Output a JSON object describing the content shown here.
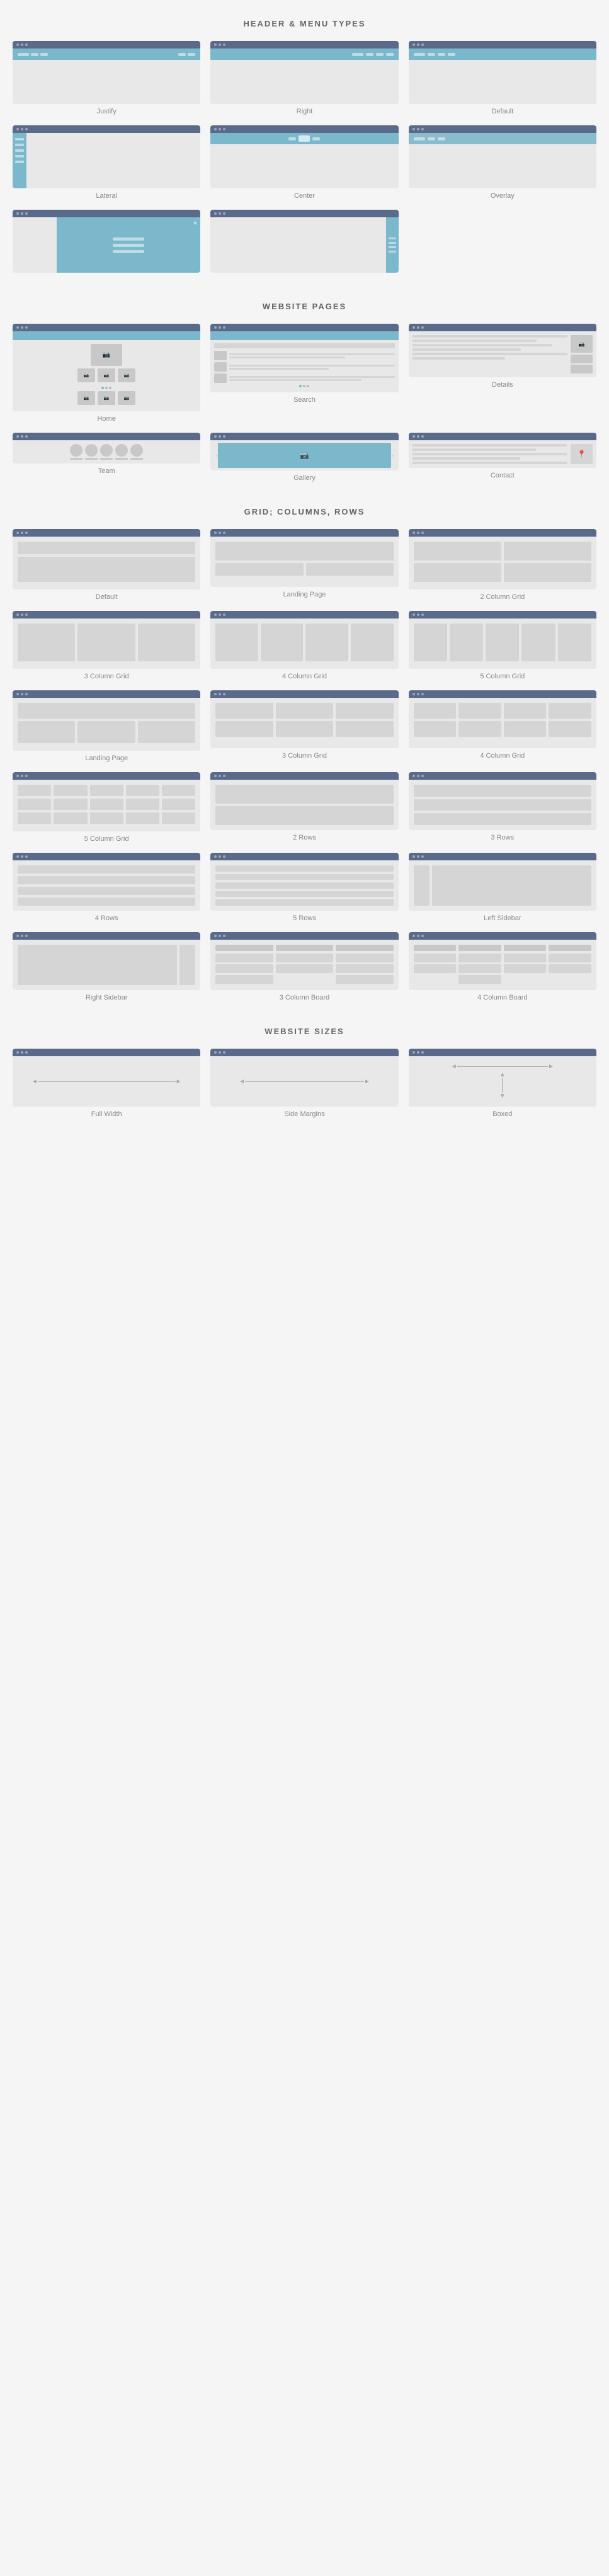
{
  "sections": {
    "header_menu": {
      "title": "HEADER & MENU TYPES",
      "items": [
        {
          "label": "Justify"
        },
        {
          "label": "Right"
        },
        {
          "label": "Default"
        },
        {
          "label": "Lateral"
        },
        {
          "label": "Center"
        },
        {
          "label": "Overlay"
        },
        {
          "label": ""
        },
        {
          "label": ""
        },
        {
          "label": ""
        }
      ]
    },
    "website_pages": {
      "title": "WEBSITE PAGES",
      "items": [
        {
          "label": "Home"
        },
        {
          "label": "Search"
        },
        {
          "label": "Details"
        },
        {
          "label": "Team"
        },
        {
          "label": "Gallery"
        },
        {
          "label": "Contact"
        }
      ]
    },
    "grid_columns_rows": {
      "title": "GRID; COLUMNS, ROWS",
      "items": [
        {
          "label": "Default"
        },
        {
          "label": "Landing Page"
        },
        {
          "label": "2 Column Grid"
        },
        {
          "label": "3 Column Grid"
        },
        {
          "label": "4 Column Grid"
        },
        {
          "label": "5 Column Grid"
        },
        {
          "label": "Landing Page"
        },
        {
          "label": "3 Column Grid"
        },
        {
          "label": "4 Column Grid"
        },
        {
          "label": "5 Column Grid"
        },
        {
          "label": "2 Rows"
        },
        {
          "label": "3 Rows"
        },
        {
          "label": "4 Rows"
        },
        {
          "label": "5 Rows"
        },
        {
          "label": "Left Sidebar"
        },
        {
          "label": "Right Sidebar"
        },
        {
          "label": "3 Column Board"
        },
        {
          "label": "4 Column Board"
        }
      ]
    },
    "website_sizes": {
      "title": "WEBSITE SIZES",
      "items": [
        {
          "label": "Full Width"
        },
        {
          "label": "Side Margins"
        },
        {
          "label": "Boxed"
        }
      ]
    }
  }
}
